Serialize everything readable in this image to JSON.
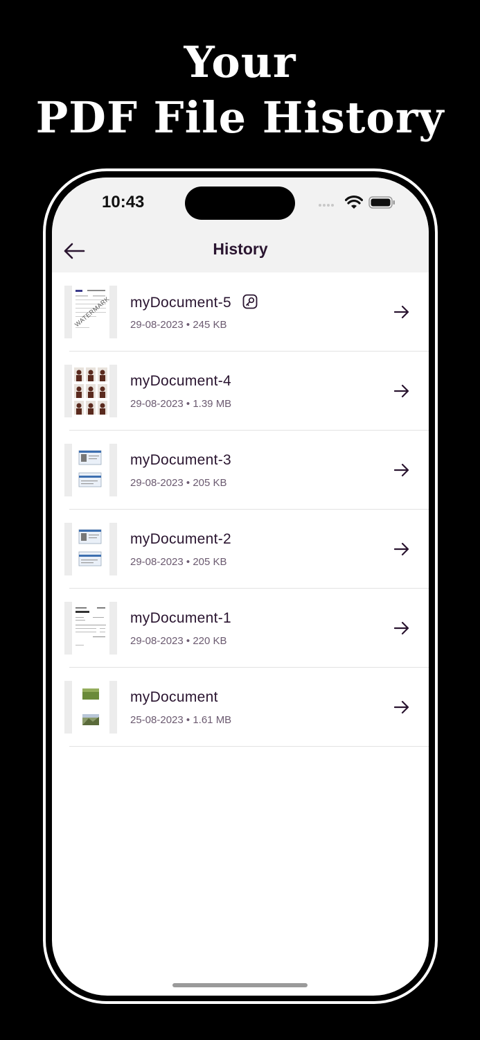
{
  "headline": {
    "line1": "Your",
    "line2": "PDF File History"
  },
  "status_bar": {
    "time": "10:43"
  },
  "nav": {
    "title": "History",
    "back_icon": "arrow-left-icon"
  },
  "colors": {
    "accent": "#2a1530",
    "meta": "#6b5a70",
    "header_bg": "#f2f2f2"
  },
  "documents": [
    {
      "name": "myDocument-5",
      "date": "29-08-2023",
      "size": "245 KB",
      "locked": true,
      "thumb_watermark": "WATERMARK",
      "thumb": "document-watermark"
    },
    {
      "name": "myDocument-4",
      "date": "29-08-2023",
      "size": "1.39 MB",
      "locked": false,
      "thumb": "photo-grid"
    },
    {
      "name": "myDocument-3",
      "date": "29-08-2023",
      "size": "205 KB",
      "locked": false,
      "thumb": "id-card"
    },
    {
      "name": "myDocument-2",
      "date": "29-08-2023",
      "size": "205 KB",
      "locked": false,
      "thumb": "id-card"
    },
    {
      "name": "myDocument-1",
      "date": "29-08-2023",
      "size": "220 KB",
      "locked": false,
      "thumb": "invoice"
    },
    {
      "name": "myDocument",
      "date": "25-08-2023",
      "size": "1.61 MB",
      "locked": false,
      "thumb": "landscape-photos"
    }
  ]
}
